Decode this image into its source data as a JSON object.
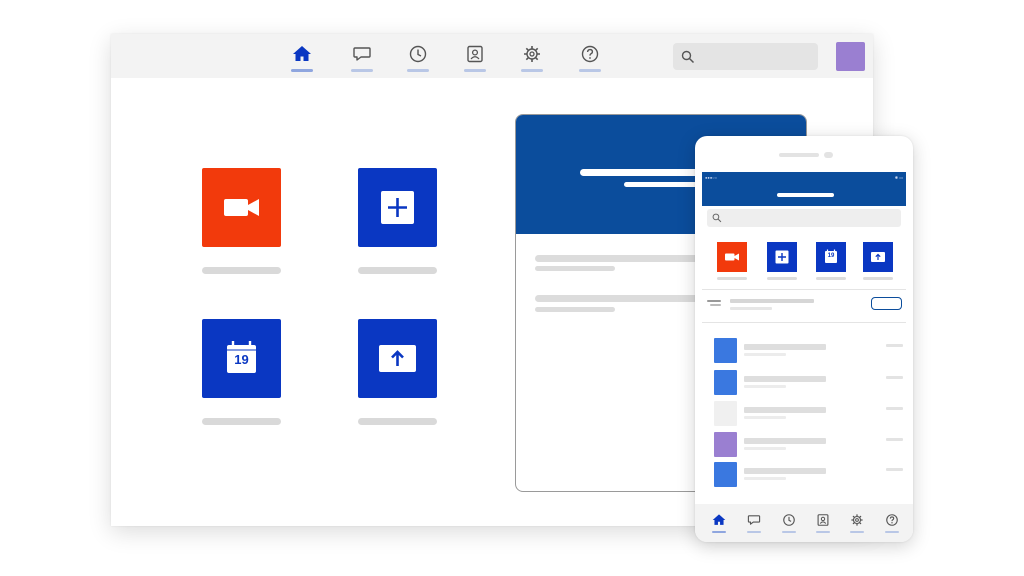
{
  "desktop": {
    "nav": {
      "items": [
        {
          "icon": "home-icon",
          "active": true
        },
        {
          "icon": "chat-icon",
          "active": false
        },
        {
          "icon": "clock-icon",
          "active": false
        },
        {
          "icon": "contact-icon",
          "active": false
        },
        {
          "icon": "gear-icon",
          "active": false
        },
        {
          "icon": "help-icon",
          "active": false
        }
      ]
    },
    "search": {
      "icon": "search-icon",
      "placeholder": ""
    },
    "avatar": {
      "color": "#9a7fd1"
    },
    "tiles": [
      {
        "icon": "video-camera-icon",
        "color": "#f23a0c"
      },
      {
        "icon": "plus-icon",
        "color": "#0a37c2"
      },
      {
        "icon": "calendar-icon",
        "color": "#0a37c2",
        "text": "19"
      },
      {
        "icon": "upload-icon",
        "color": "#0a37c2"
      }
    ],
    "card": {
      "header_color": "#0b4d9c"
    }
  },
  "phone": {
    "header_color": "#0b4d9c",
    "status": {
      "left": "●●●○○",
      "right": "✱ ▭"
    },
    "search": {
      "icon": "search-icon",
      "placeholder": ""
    },
    "tiles": [
      {
        "icon": "video-camera-icon",
        "color": "#f23a0c"
      },
      {
        "icon": "plus-icon",
        "color": "#0a37c2"
      },
      {
        "icon": "calendar-icon",
        "color": "#0a37c2",
        "text": "19"
      },
      {
        "icon": "upload-icon",
        "color": "#0a37c2"
      }
    ],
    "list": [
      {
        "thumb_color": "#3a78e0"
      },
      {
        "thumb_color": "#3a78e0"
      },
      {
        "thumb_color": "#f0f0f0"
      },
      {
        "thumb_color": "#9a7fd1"
      },
      {
        "thumb_color": "#3a78e0"
      }
    ],
    "nav": {
      "items": [
        {
          "icon": "home-icon",
          "active": true
        },
        {
          "icon": "chat-icon",
          "active": false
        },
        {
          "icon": "clock-icon",
          "active": false
        },
        {
          "icon": "contact-icon",
          "active": false
        },
        {
          "icon": "gear-icon",
          "active": false
        },
        {
          "icon": "help-icon",
          "active": false
        }
      ]
    }
  },
  "colors": {
    "accent": "#0a37c2",
    "brand_blue": "#0b4d9c",
    "nav_icon": "#555555",
    "video_red": "#f23a0c"
  }
}
